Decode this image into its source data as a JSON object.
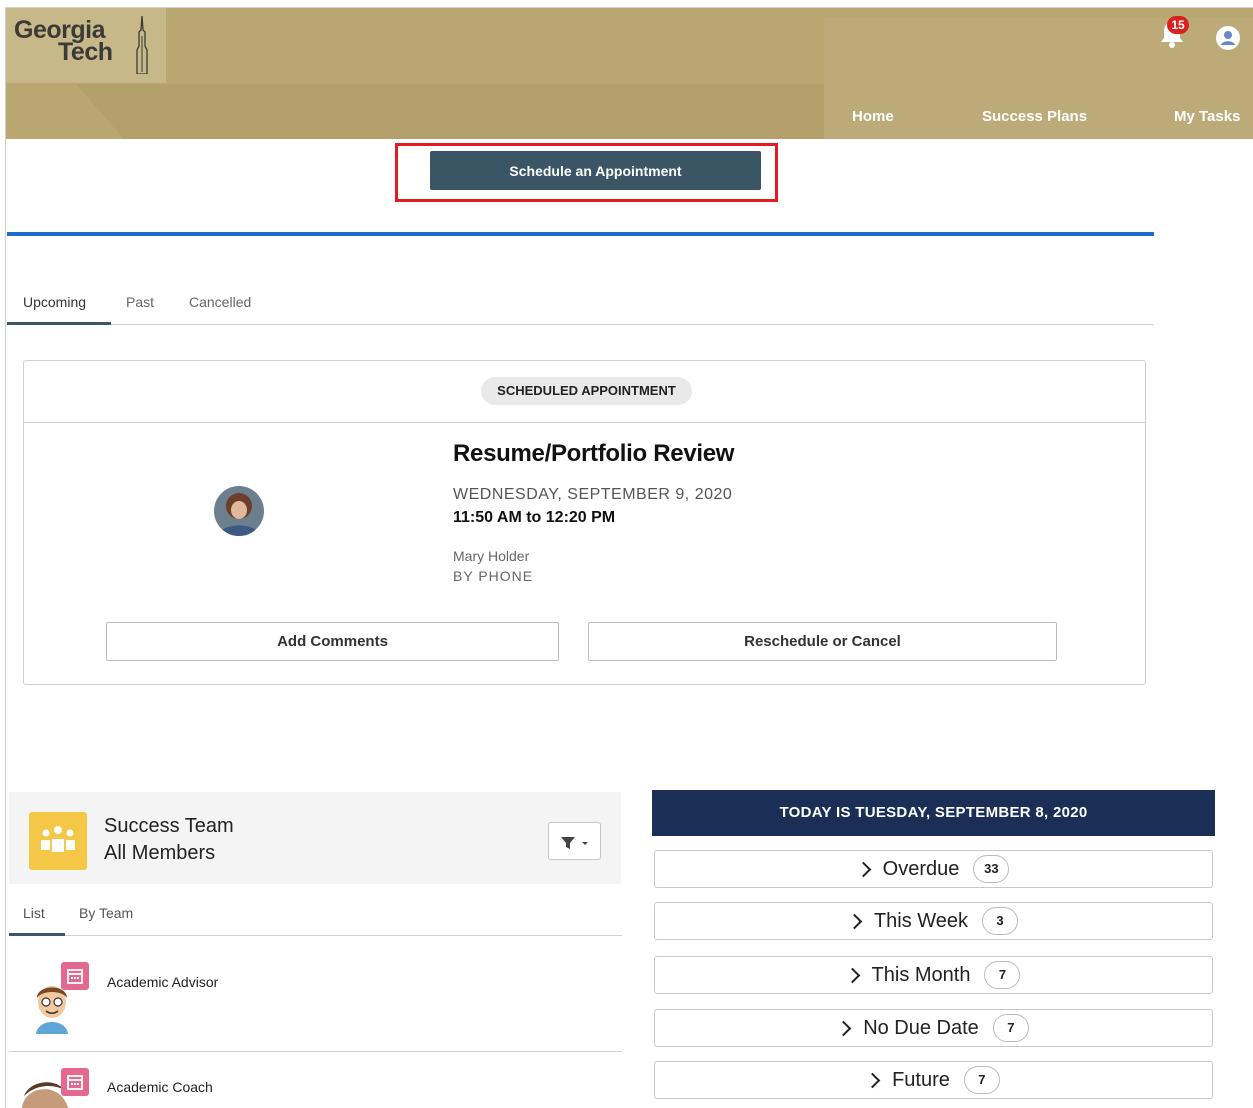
{
  "header": {
    "logo_line1": "Georgia",
    "logo_line2": "Tech",
    "notification_count": "15",
    "nav": [
      "Home",
      "Success Plans",
      "My Tasks"
    ]
  },
  "schedule": {
    "button_label": "Schedule an Appointment"
  },
  "tabs": [
    "Upcoming",
    "Past",
    "Cancelled"
  ],
  "appointment": {
    "status": "SCHEDULED APPOINTMENT",
    "title": "Resume/Portfolio Review",
    "date": "WEDNESDAY, SEPTEMBER 9, 2020",
    "time": "11:50 AM to 12:20 PM",
    "person": "Mary Holder",
    "mode": "BY PHONE",
    "add_comments_label": "Add Comments",
    "reschedule_label": "Reschedule or Cancel"
  },
  "success_team": {
    "title": "Success Team",
    "subtitle": "All Members",
    "tabs": [
      "List",
      "By Team"
    ],
    "members": [
      "Academic Advisor",
      "Academic Coach"
    ]
  },
  "tasks": {
    "today": "TODAY IS TUESDAY, SEPTEMBER 8, 2020",
    "rows": [
      {
        "label": "Overdue",
        "count": "33"
      },
      {
        "label": "This Week",
        "count": "3"
      },
      {
        "label": "This Month",
        "count": "7"
      },
      {
        "label": "No Due Date",
        "count": "7"
      },
      {
        "label": "Future",
        "count": "7"
      }
    ]
  },
  "colors": {
    "header_gold": "#b9a771",
    "button_slate": "#3a5665",
    "accent_blue": "#1d6bc9",
    "highlight_red": "#e41b23",
    "today_navy": "#1b2e55",
    "team_yellow": "#f4c747",
    "calendar_pink": "#e36a8e"
  }
}
